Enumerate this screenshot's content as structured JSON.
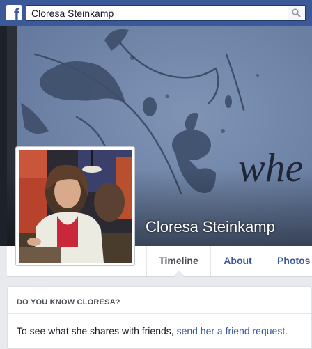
{
  "topbar": {
    "logo_letter": "f",
    "search_value": "Cloresa Steinkamp",
    "icons": {
      "logo": "facebook-logo",
      "search": "search-icon"
    }
  },
  "cover": {
    "art_text": "whe",
    "colors": {
      "background": "#6e83a6",
      "ink": "#3e4e6a"
    }
  },
  "profile": {
    "name": "Cloresa Steinkamp"
  },
  "nav": {
    "tabs": [
      {
        "label": "Timeline",
        "active": true
      },
      {
        "label": "About",
        "active": false
      },
      {
        "label": "Photos",
        "active": false
      }
    ]
  },
  "know_card": {
    "title": "DO YOU KNOW CLORESA?",
    "body_prefix": "To see what she shares with friends, ",
    "link_text": "send her a friend request."
  },
  "colors": {
    "brand": "#3b5998",
    "page_bg": "#e9eaed",
    "text": "#141823"
  }
}
